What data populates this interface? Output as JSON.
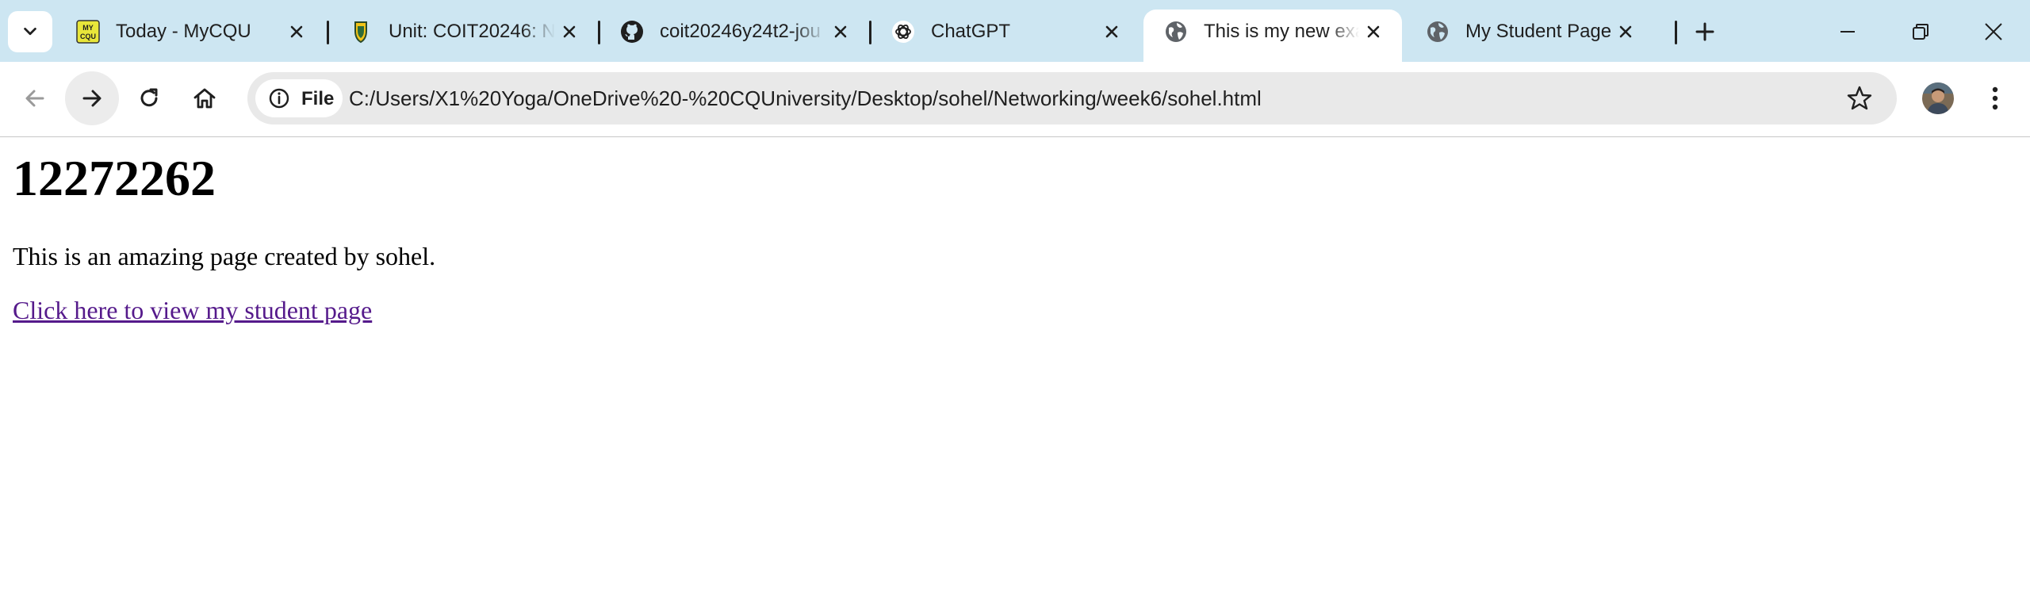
{
  "tabs": [
    {
      "title": "Today - MyCQU",
      "favicon": "mycqu-icon"
    },
    {
      "title": "Unit: COIT20246: N",
      "favicon": "shield-logo-icon"
    },
    {
      "title": "coit20246y24t2-jou",
      "favicon": "github-icon"
    },
    {
      "title": "ChatGPT",
      "favicon": "chatgpt-icon"
    },
    {
      "title": "This is my new exa",
      "favicon": "globe-icon",
      "active": true
    },
    {
      "title": "My Student Page",
      "favicon": "globe-icon"
    }
  ],
  "toolbar": {
    "site_info_label": "File",
    "url": "C:/Users/X1%20Yoga/OneDrive%20-%20CQUniversity/Desktop/sohel/Networking/week6/sohel.html"
  },
  "page": {
    "heading": "12272262",
    "paragraph": "This is an amazing page created by sohel.",
    "link_text": "Click here to view my student page"
  },
  "colors": {
    "tabstrip_bg": "#cde6f2",
    "visited_link": "#551a8b",
    "mycqu_yellow": "#e8e63a"
  }
}
